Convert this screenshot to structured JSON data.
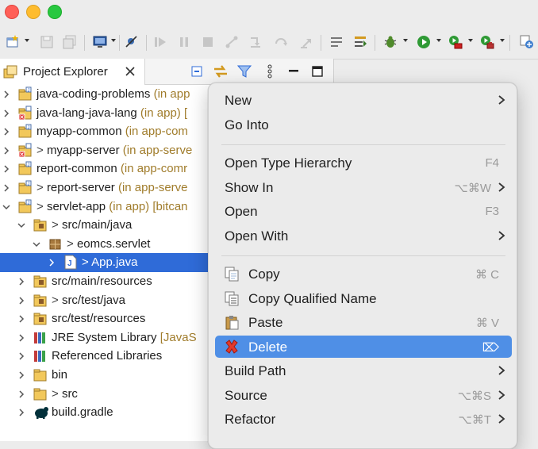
{
  "window": {
    "buttons": [
      "close",
      "minimize",
      "zoom"
    ]
  },
  "toolbar": {
    "icons": [
      "new-wizard-icon",
      "save-icon",
      "save-all-icon",
      "open-terminal-icon",
      "skip-breakpoints-icon",
      "resume-icon",
      "suspend-icon",
      "terminate-icon",
      "disconnect-icon",
      "step-into-icon",
      "step-over-icon",
      "step-return-icon",
      "use-step-filters-icon",
      "toggle-word-wrap-icon",
      "next-annotation-icon",
      "debug-icon",
      "run-icon",
      "run-last-tool-icon",
      "external-tools-icon",
      "open-perspective-icon"
    ]
  },
  "view": {
    "tab_label": "Project Explorer",
    "header_icons": [
      "collapse-all-icon",
      "link-with-editor-icon",
      "filter-icon",
      "view-menu-icon",
      "minimize-icon",
      "maximize-icon"
    ]
  },
  "tree": {
    "rows": [
      {
        "prefix": "",
        "name": "java-coding-problems",
        "decoration": " (in app",
        "expanded": false,
        "icon": "project-icon"
      },
      {
        "prefix": "",
        "name": "java-lang-java-lang",
        "decoration": " (in app) [",
        "expanded": false,
        "icon": "project-error-icon"
      },
      {
        "prefix": "",
        "name": "myapp-common",
        "decoration": " (in app-com",
        "expanded": false,
        "icon": "project-icon"
      },
      {
        "prefix": "> ",
        "name": "myapp-server",
        "decoration": " (in app-serve",
        "expanded": false,
        "icon": "project-error-icon"
      },
      {
        "prefix": "",
        "name": "report-common",
        "decoration": " (in app-comr",
        "expanded": false,
        "icon": "project-icon"
      },
      {
        "prefix": "> ",
        "name": "report-server",
        "decoration": " (in app-serve",
        "expanded": false,
        "icon": "project-icon"
      },
      {
        "prefix": "> ",
        "name": "servlet-app",
        "decoration": " (in app) [bitcan",
        "expanded": true,
        "icon": "project-icon"
      },
      {
        "prefix": "> ",
        "name": "src/main/java",
        "decoration": "",
        "expanded": true,
        "icon": "source-folder-icon"
      },
      {
        "prefix": "> ",
        "name": "eomcs.servlet",
        "decoration": "",
        "expanded": true,
        "icon": "package-icon"
      },
      {
        "prefix": "> ",
        "name": "App.java",
        "decoration": "",
        "expanded": false,
        "icon": "java-file-icon",
        "selected": true
      },
      {
        "prefix": "",
        "name": "src/main/resources",
        "decoration": "",
        "expanded": false,
        "icon": "source-folder-icon"
      },
      {
        "prefix": "> ",
        "name": "src/test/java",
        "decoration": "",
        "expanded": false,
        "icon": "source-folder-icon"
      },
      {
        "prefix": "",
        "name": "src/test/resources",
        "decoration": "",
        "expanded": false,
        "icon": "source-folder-icon"
      },
      {
        "prefix": "",
        "name": "JRE System Library",
        "decoration": " [JavaS",
        "expanded": false,
        "icon": "library-icon"
      },
      {
        "prefix": "",
        "name": "Referenced Libraries",
        "decoration": "",
        "expanded": false,
        "icon": "library-icon"
      },
      {
        "prefix": "",
        "name": "bin",
        "decoration": "",
        "expanded": false,
        "icon": "folder-icon"
      },
      {
        "prefix": "> ",
        "name": "src",
        "decoration": "",
        "expanded": false,
        "icon": "folder-icon"
      },
      {
        "prefix": "",
        "name": "build.gradle",
        "decoration": "",
        "expanded": false,
        "icon": "gradle-file-icon"
      }
    ]
  },
  "context_menu": {
    "items": [
      {
        "label": "New",
        "shortcut": "",
        "submenu": true
      },
      {
        "label": "Go Into",
        "shortcut": "",
        "submenu": false
      },
      {
        "separator": true
      },
      {
        "label": "Open Type Hierarchy",
        "shortcut": "F4",
        "submenu": false
      },
      {
        "label": "Show In",
        "shortcut": "⌥⌘W",
        "submenu": true
      },
      {
        "label": "Open",
        "shortcut": "F3",
        "submenu": false
      },
      {
        "label": "Open With",
        "shortcut": "",
        "submenu": true
      },
      {
        "separator": true
      },
      {
        "label": "Copy",
        "shortcut": "⌘ C",
        "submenu": false,
        "icon": "copy-icon"
      },
      {
        "label": "Copy Qualified Name",
        "shortcut": "",
        "submenu": false,
        "icon": "copy-qualified-name-icon"
      },
      {
        "label": "Paste",
        "shortcut": "⌘ V",
        "submenu": false,
        "icon": "paste-icon"
      },
      {
        "label": "Delete",
        "shortcut": "⌦",
        "submenu": false,
        "icon": "delete-icon",
        "highlighted": true
      },
      {
        "label": "Build Path",
        "shortcut": "",
        "submenu": true
      },
      {
        "label": "Source",
        "shortcut": "⌥⌘S",
        "submenu": true
      },
      {
        "label": "Refactor",
        "shortcut": "⌥⌘T",
        "submenu": true
      }
    ]
  },
  "colors": {
    "selection": "#2f6bd8",
    "menu_highlight": "#4f8fe6",
    "decoration": "#a07c2b"
  }
}
